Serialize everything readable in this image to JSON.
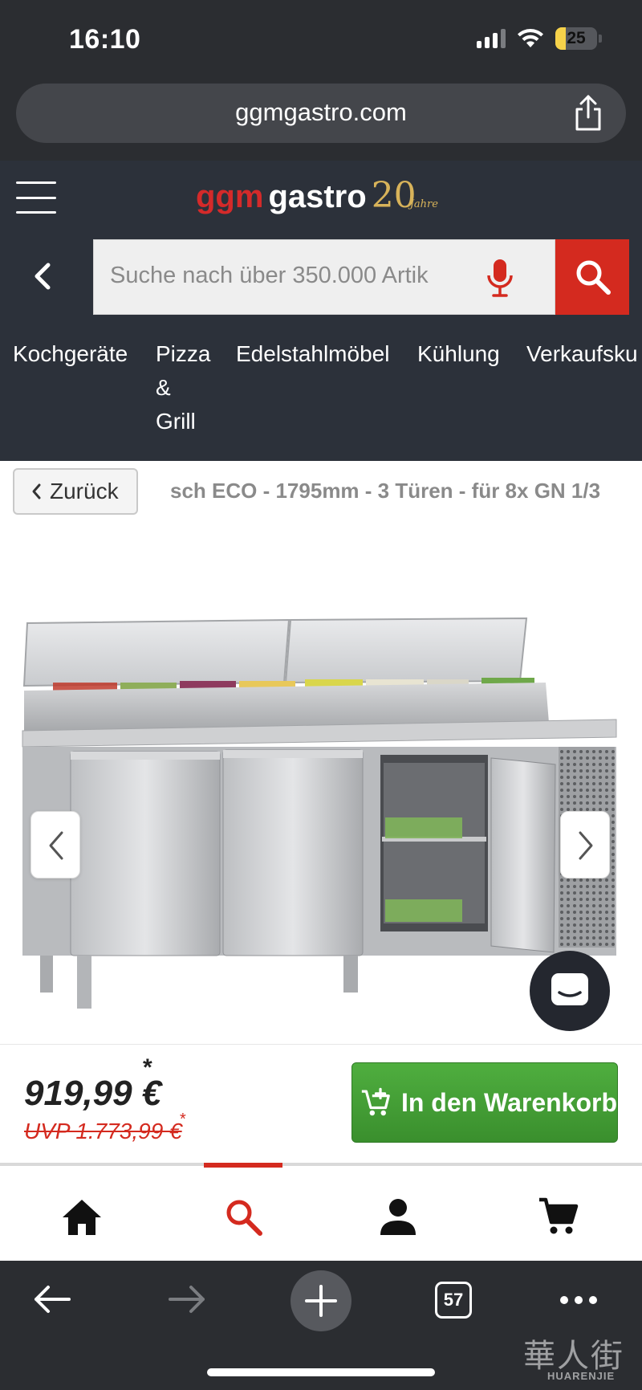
{
  "status_bar": {
    "time": "16:10",
    "battery": "25",
    "battery_level": 0.25
  },
  "browser": {
    "url": "ggmgastro.com",
    "tab_count": "57"
  },
  "site": {
    "logo": {
      "ggm": "ggm",
      "gastro": "gastro",
      "anniversary": "20",
      "anniversary_suffix": "Jahre"
    },
    "search": {
      "placeholder": "Suche nach über 350.000 Artik"
    },
    "nav": [
      {
        "label": "Kochgeräte"
      },
      {
        "label": "Pizza",
        "label2": "&",
        "label3": "Grill"
      },
      {
        "label": "Edelstahlmöbel"
      },
      {
        "label": "Kühlung"
      },
      {
        "label": "Verkaufsku"
      }
    ]
  },
  "breadcrumb": {
    "back_label": "Zurück",
    "product_title": "sch ECO - 1795mm - 3 Türen - für 8x GN 1/3"
  },
  "product": {
    "price": "919,99 €",
    "price_footnote": "*",
    "uvp": "UVP 1.773,99 €",
    "uvp_footnote": "*",
    "add_to_cart_label": "In den Warenkorb"
  },
  "bottom_nav": {
    "items": [
      {
        "icon": "home-icon"
      },
      {
        "icon": "search-icon",
        "active": true
      },
      {
        "icon": "user-icon"
      },
      {
        "icon": "cart-icon"
      }
    ]
  },
  "watermark": {
    "chinese": "華人街",
    "latin": "HUARENJIE"
  },
  "colors": {
    "header_bg": "#2c313a",
    "brand_red": "#d42a1f",
    "cart_green": "#45a036",
    "browser_chrome": "#2b2d31",
    "logo_gold": "#d8b35a"
  }
}
